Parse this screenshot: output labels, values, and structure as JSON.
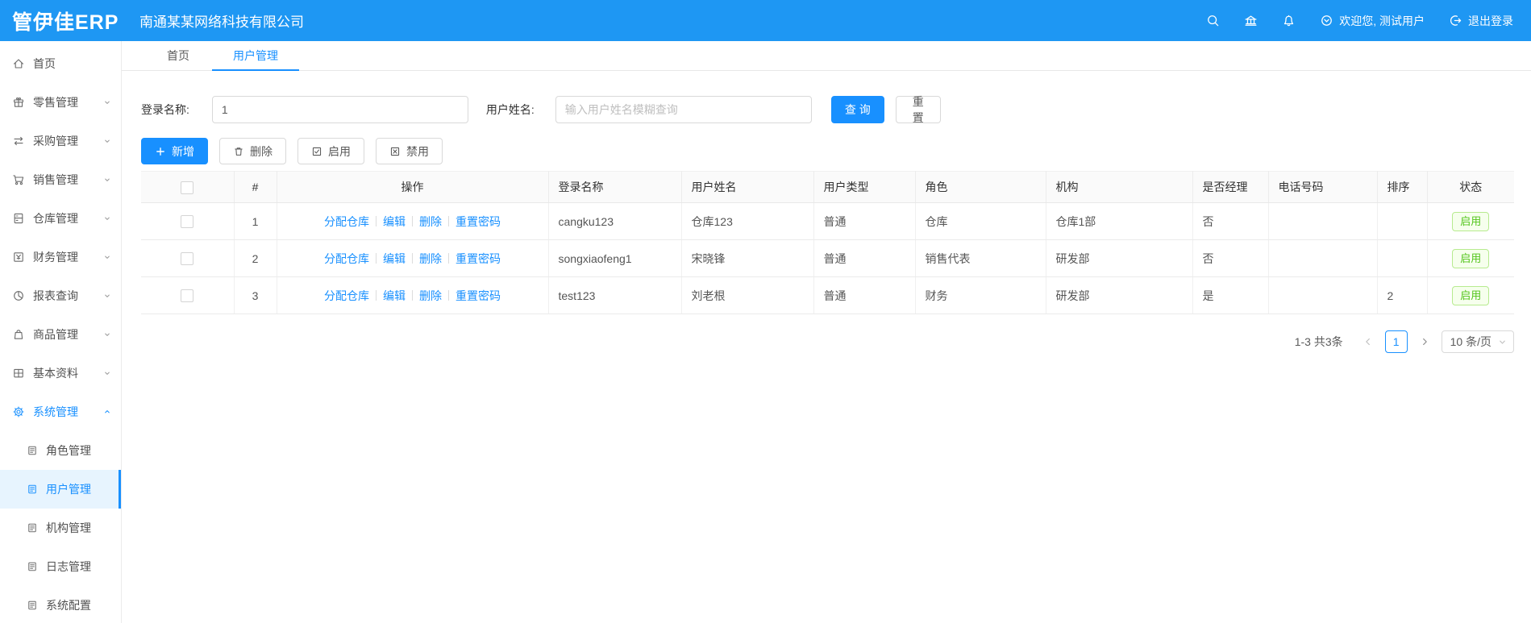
{
  "header": {
    "logo": "管伊佳ERP",
    "company": "南通某某网络科技有限公司",
    "welcome_text": "欢迎您, 测试用户",
    "logout_text": "退出登录",
    "icons": [
      "search",
      "bank",
      "bell",
      "user-dropdown",
      "logout"
    ]
  },
  "tabs": [
    {
      "label": "首页",
      "active": false
    },
    {
      "label": "用户管理",
      "active": true
    }
  ],
  "sidebar": {
    "items": [
      {
        "label": "首页",
        "icon": "home"
      },
      {
        "label": "零售管理",
        "icon": "gift"
      },
      {
        "label": "采购管理",
        "icon": "swap-arrows"
      },
      {
        "label": "销售管理",
        "icon": "cart"
      },
      {
        "label": "仓库管理",
        "icon": "storage"
      },
      {
        "label": "财务管理",
        "icon": "finance"
      },
      {
        "label": "报表查询",
        "icon": "pie-chart"
      },
      {
        "label": "商品管理",
        "icon": "bag"
      },
      {
        "label": "基本资料",
        "icon": "grid"
      },
      {
        "label": "系统管理",
        "icon": "gear",
        "expanded": true,
        "active": true
      }
    ],
    "system_children": [
      {
        "label": "角色管理",
        "icon": "doc"
      },
      {
        "label": "用户管理",
        "icon": "doc",
        "active": true
      },
      {
        "label": "机构管理",
        "icon": "doc"
      },
      {
        "label": "日志管理",
        "icon": "doc"
      },
      {
        "label": "系统配置",
        "icon": "doc"
      }
    ]
  },
  "search": {
    "login_label": "登录名称:",
    "login_value": "1",
    "name_label": "用户姓名:",
    "name_placeholder": "输入用户姓名模糊查询",
    "query_label": "查 询",
    "reset_label": "重 置"
  },
  "toolbar": {
    "add_label": "新增",
    "delete_label": "删除",
    "enable_label": "启用",
    "disable_label": "禁用"
  },
  "table": {
    "columns": [
      "#",
      "操作",
      "登录名称",
      "用户姓名",
      "用户类型",
      "角色",
      "机构",
      "是否经理",
      "电话号码",
      "排序",
      "状态"
    ],
    "action_links": [
      "分配仓库",
      "编辑",
      "删除",
      "重置密码"
    ],
    "rows": [
      {
        "index": "1",
        "login": "cangku123",
        "name": "仓库123",
        "type": "普通",
        "role": "仓库",
        "org": "仓库1部",
        "manager": "否",
        "phone": "",
        "sort": "",
        "status": "启用"
      },
      {
        "index": "2",
        "login": "songxiaofeng1",
        "name": "宋晓锋",
        "type": "普通",
        "role": "销售代表",
        "org": "研发部",
        "manager": "否",
        "phone": "",
        "sort": "",
        "status": "启用"
      },
      {
        "index": "3",
        "login": "test123",
        "name": "刘老根",
        "type": "普通",
        "role": "财务",
        "org": "研发部",
        "manager": "是",
        "phone": "",
        "sort": "2",
        "status": "启用"
      }
    ]
  },
  "pagination": {
    "total_text": "1-3 共3条",
    "current_page": "1",
    "page_size_text": "10 条/页"
  },
  "colors": {
    "primary": "#1890ff",
    "topbar_blue": "#1e97f3",
    "status_green": "#52c41a",
    "status_green_border": "#b7eb8f",
    "status_green_bg": "#f6ffed",
    "active_menu_bg": "#e7f4fe"
  }
}
